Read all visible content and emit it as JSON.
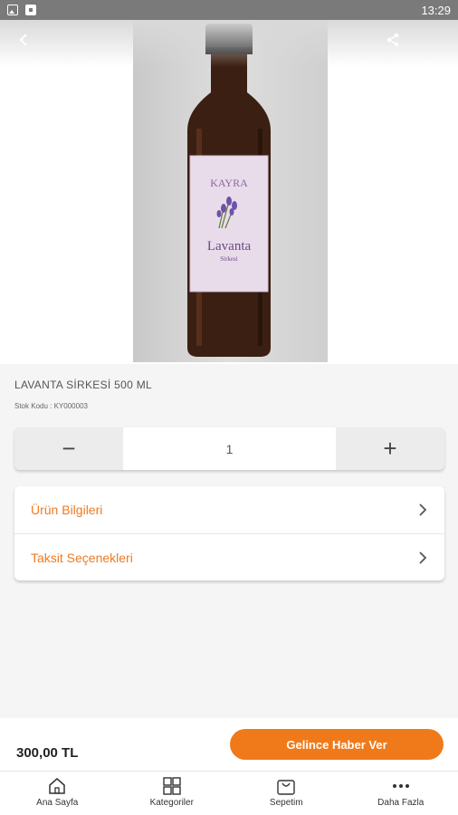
{
  "status_bar": {
    "time": "13:29"
  },
  "product": {
    "title": "LAVANTA SİRKESİ 500 ML",
    "stock_label": "Stok Kodu :",
    "stock_code": "KY000003",
    "label_brand": "KAYRA",
    "label_name": "Lavanta",
    "label_sub": "Sirkesi"
  },
  "quantity": {
    "minus": "−",
    "value": "1",
    "plus": "+"
  },
  "info_rows": [
    {
      "label": "Ürün Bilgileri"
    },
    {
      "label": "Taksit Seçenekleri"
    }
  ],
  "purchase": {
    "price": "300,00 TL",
    "notify_label": "Gelince Haber Ver"
  },
  "tabs": [
    {
      "label": "Ana Sayfa",
      "icon": "home-icon"
    },
    {
      "label": "Kategoriler",
      "icon": "grid-icon"
    },
    {
      "label": "Sepetim",
      "icon": "cart-icon"
    },
    {
      "label": "Daha Fazla",
      "icon": "more-dots-icon"
    }
  ],
  "colors": {
    "accent": "#f07a1a",
    "accent_text": "#ee7a22"
  }
}
